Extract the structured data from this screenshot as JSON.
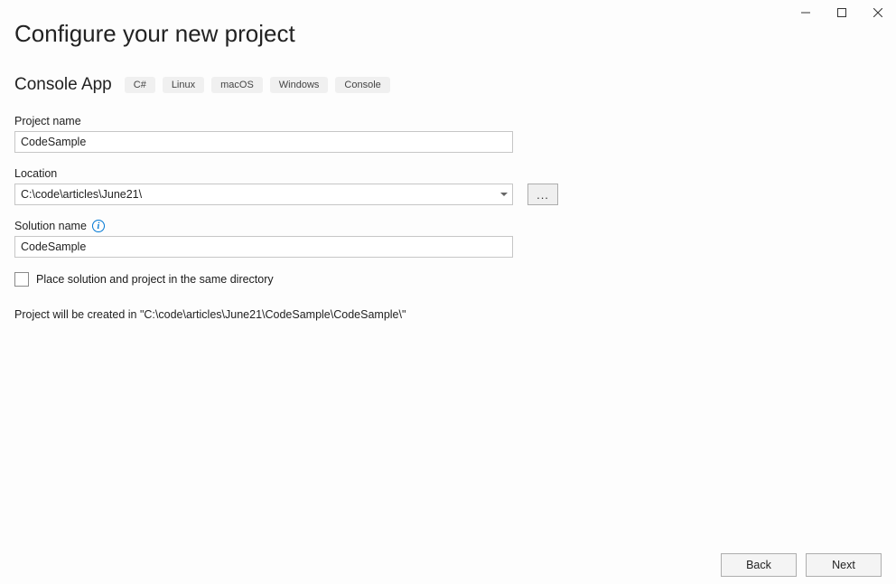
{
  "title": "Configure your new project",
  "template": {
    "name": "Console App",
    "tags": [
      "C#",
      "Linux",
      "macOS",
      "Windows",
      "Console"
    ]
  },
  "fields": {
    "project_name_label": "Project name",
    "project_name_value": "CodeSample",
    "location_label": "Location",
    "location_value": "C:\\code\\articles\\June21\\",
    "browse_label": "...",
    "solution_name_label": "Solution name",
    "solution_name_value": "CodeSample",
    "same_dir_label": "Place solution and project in the same directory"
  },
  "path_preview": "Project will be created in \"C:\\code\\articles\\June21\\CodeSample\\CodeSample\\\"",
  "footer": {
    "back": "Back",
    "next": "Next"
  }
}
